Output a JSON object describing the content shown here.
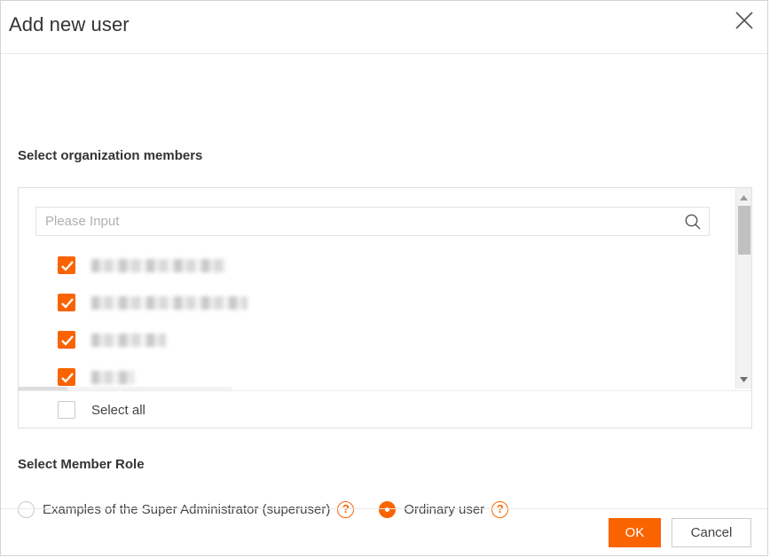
{
  "dialog": {
    "title": "Add new user",
    "close_icon": "close-icon"
  },
  "members_section": {
    "label": "Select organization members",
    "search": {
      "placeholder": "Please Input",
      "value": "",
      "icon": "search-icon"
    },
    "items": [
      {
        "checked": true,
        "label": "",
        "redacted": true,
        "width": 152
      },
      {
        "checked": true,
        "label": "",
        "redacted": true,
        "width": 176
      },
      {
        "checked": true,
        "label": "",
        "redacted": true,
        "width": 84
      },
      {
        "checked": true,
        "label": "",
        "redacted": true,
        "width": 48
      }
    ],
    "select_all": {
      "label": "Select all",
      "checked": false
    },
    "scrollbar": {
      "up_arrow_icon": "chevron-up-icon",
      "down_arrow_icon": "chevron-down-icon"
    }
  },
  "role_section": {
    "label": "Select Member Role",
    "options": [
      {
        "label": "Examples of the Super Administrator (superuser)",
        "selected": false,
        "help_icon": "help-icon",
        "help_glyph": "?"
      },
      {
        "label": "Ordinary user",
        "selected": true,
        "help_icon": "help-icon",
        "help_glyph": "?"
      }
    ]
  },
  "footer": {
    "ok_label": "OK",
    "cancel_label": "Cancel"
  },
  "colors": {
    "accent": "#fa6400",
    "text": "#333333",
    "muted": "#b0b0b0",
    "border": "#e0e0e0"
  }
}
